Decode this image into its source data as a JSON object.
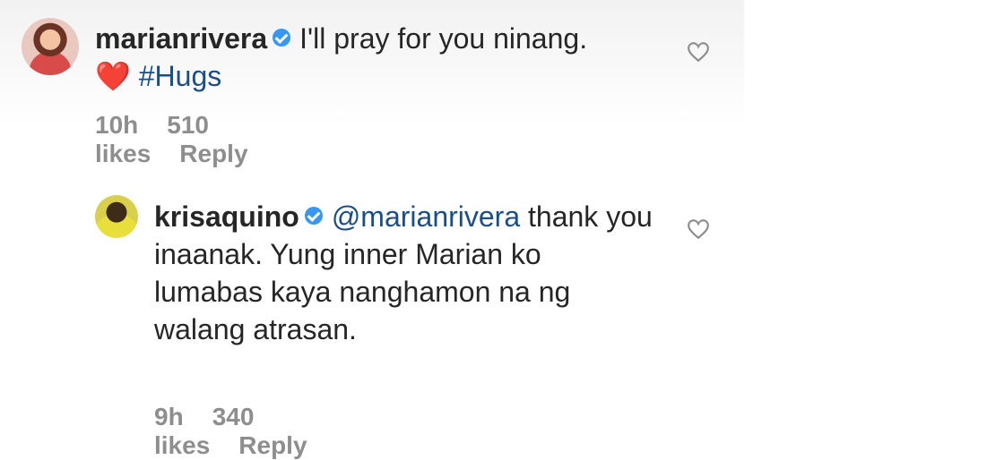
{
  "comments": [
    {
      "username": "marianrivera",
      "text": "I'll pray for you ninang. ",
      "emoji": "❤️",
      "hashtag": "#Hugs",
      "time": "10h",
      "likes": "510 likes",
      "reply_label": "Reply"
    },
    {
      "username": "krisaquino",
      "mention": "@marianrivera",
      "text": " thank you inaanak. Yung inner Marian ko lumabas kaya nanghamon na ng walang atrasan.",
      "time": "9h",
      "likes": "340 likes",
      "reply_label": "Reply"
    }
  ],
  "icons": {
    "verified": "verified-badge-icon",
    "like": "heart-outline-icon"
  },
  "colors": {
    "verified": "#3897f0",
    "hashtag": "#1a4e8a",
    "meta": "#8e8e8e",
    "emoji_heart": "#e0262b"
  }
}
